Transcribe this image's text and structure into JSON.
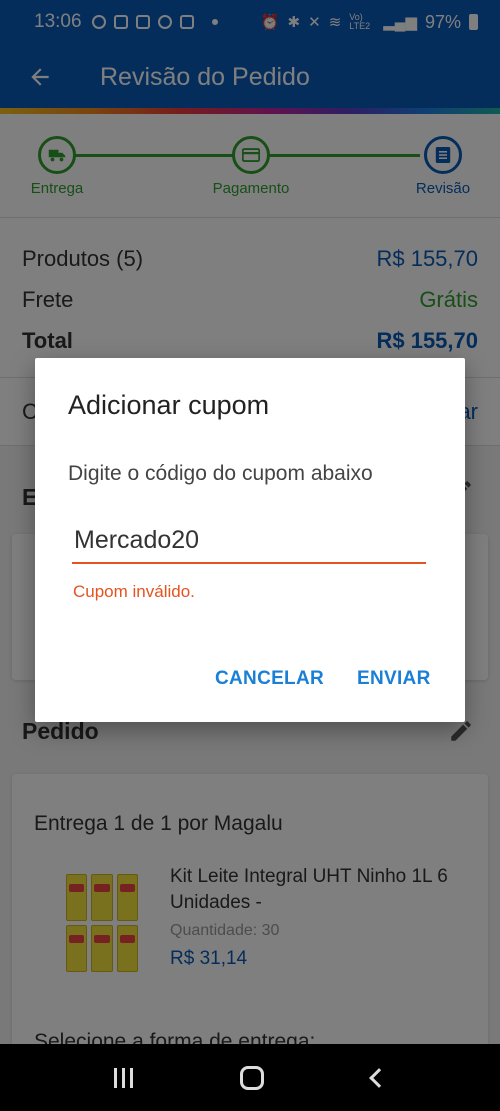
{
  "status_bar": {
    "time": "13:06",
    "battery": "97%",
    "network": "Vo) LTE2"
  },
  "app_bar": {
    "title": "Revisão do Pedido"
  },
  "stepper": {
    "steps": [
      {
        "label": "Entrega"
      },
      {
        "label": "Pagamento"
      },
      {
        "label": "Revisão"
      }
    ]
  },
  "summary": {
    "products_label": "Produtos (5)",
    "products_value": "R$ 155,70",
    "shipping_label": "Frete",
    "shipping_value": "Grátis",
    "total_label": "Total",
    "total_value": "R$ 155,70"
  },
  "coupon_row": {
    "label": "C",
    "action": "ar"
  },
  "address_section": {
    "title": "E"
  },
  "order_section": {
    "title": "Pedido",
    "delivery_title": "Entrega 1 de 1 por Magalu",
    "product": {
      "name": "Kit Leite Integral UHT Ninho 1L 6 Unidades -",
      "quantity_label": "Quantidade:",
      "quantity": "30",
      "price": "R$ 31,14"
    },
    "shipping_select": "Selecione a forma de entrega:"
  },
  "dialog": {
    "title": "Adicionar cupom",
    "message": "Digite o código do cupom abaixo",
    "input_value": "Mercado20",
    "error": "Cupom inválido.",
    "cancel_label": "CANCELAR",
    "send_label": "ENVIAR"
  },
  "colors": {
    "primary": "#0a5bb6",
    "success": "#2e9e2e",
    "error": "#e5531f",
    "button": "#1a7fd6"
  }
}
